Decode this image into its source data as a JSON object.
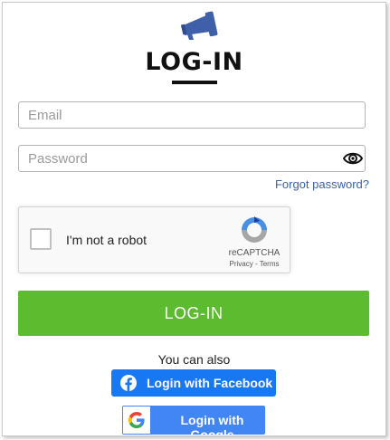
{
  "header": {
    "logo_icon": "megaphone-icon",
    "title": "LOG-IN"
  },
  "form": {
    "email": {
      "placeholder": "Email",
      "value": ""
    },
    "password": {
      "placeholder": "Password",
      "value": "",
      "toggle_icon": "eye-icon"
    },
    "forgot_link": "Forgot password?"
  },
  "recaptcha": {
    "checkbox_label": "I'm not a robot",
    "brand": "reCAPTCHA",
    "privacy": "Privacy",
    "separator": " - ",
    "terms": "Terms",
    "checked": false
  },
  "actions": {
    "login_button": "LOG-IN",
    "alternative_text": "You can also",
    "facebook_button": "Login with Facebook",
    "google_button": "Login with Google"
  },
  "colors": {
    "accent_green": "#5dbb2f",
    "facebook_blue": "#1877f2",
    "google_blue": "#4285f4",
    "link_blue": "#3a63a8",
    "logo_blue": "#3f5fa8"
  }
}
